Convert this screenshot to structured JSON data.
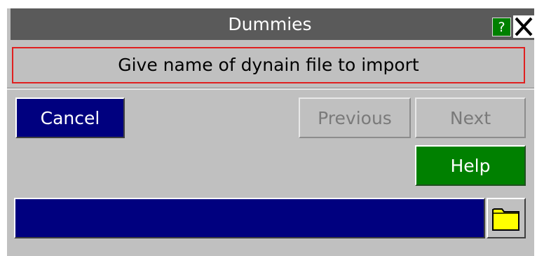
{
  "window": {
    "title": "Dummies",
    "help_glyph": "?",
    "close_glyph": "✕"
  },
  "prompt": {
    "text": "Give name of dynain file to import"
  },
  "buttons": {
    "cancel_label": "Cancel",
    "previous_label": "Previous",
    "next_label": "Next",
    "help_label": "Help"
  },
  "file_input": {
    "value": "",
    "folder_icon": "folder-icon"
  },
  "colors": {
    "dialog_bg": "#c0c0c0",
    "titlebar_bg": "#5a5a5a",
    "accent_blue": "#00007f",
    "help_green": "#008000",
    "prompt_border": "#e02020",
    "disabled_text": "#7a7a7a"
  }
}
